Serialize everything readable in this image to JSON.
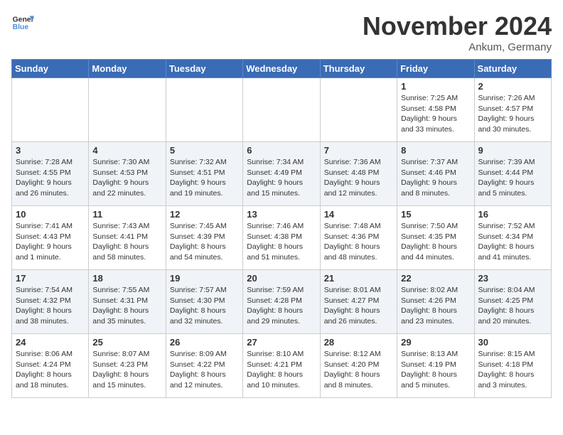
{
  "header": {
    "logo_general": "General",
    "logo_blue": "Blue",
    "month_title": "November 2024",
    "location": "Ankum, Germany"
  },
  "weekdays": [
    "Sunday",
    "Monday",
    "Tuesday",
    "Wednesday",
    "Thursday",
    "Friday",
    "Saturday"
  ],
  "weeks": [
    [
      {
        "day": "",
        "info": ""
      },
      {
        "day": "",
        "info": ""
      },
      {
        "day": "",
        "info": ""
      },
      {
        "day": "",
        "info": ""
      },
      {
        "day": "",
        "info": ""
      },
      {
        "day": "1",
        "info": "Sunrise: 7:25 AM\nSunset: 4:58 PM\nDaylight: 9 hours and 33 minutes."
      },
      {
        "day": "2",
        "info": "Sunrise: 7:26 AM\nSunset: 4:57 PM\nDaylight: 9 hours and 30 minutes."
      }
    ],
    [
      {
        "day": "3",
        "info": "Sunrise: 7:28 AM\nSunset: 4:55 PM\nDaylight: 9 hours and 26 minutes."
      },
      {
        "day": "4",
        "info": "Sunrise: 7:30 AM\nSunset: 4:53 PM\nDaylight: 9 hours and 22 minutes."
      },
      {
        "day": "5",
        "info": "Sunrise: 7:32 AM\nSunset: 4:51 PM\nDaylight: 9 hours and 19 minutes."
      },
      {
        "day": "6",
        "info": "Sunrise: 7:34 AM\nSunset: 4:49 PM\nDaylight: 9 hours and 15 minutes."
      },
      {
        "day": "7",
        "info": "Sunrise: 7:36 AM\nSunset: 4:48 PM\nDaylight: 9 hours and 12 minutes."
      },
      {
        "day": "8",
        "info": "Sunrise: 7:37 AM\nSunset: 4:46 PM\nDaylight: 9 hours and 8 minutes."
      },
      {
        "day": "9",
        "info": "Sunrise: 7:39 AM\nSunset: 4:44 PM\nDaylight: 9 hours and 5 minutes."
      }
    ],
    [
      {
        "day": "10",
        "info": "Sunrise: 7:41 AM\nSunset: 4:43 PM\nDaylight: 9 hours and 1 minute."
      },
      {
        "day": "11",
        "info": "Sunrise: 7:43 AM\nSunset: 4:41 PM\nDaylight: 8 hours and 58 minutes."
      },
      {
        "day": "12",
        "info": "Sunrise: 7:45 AM\nSunset: 4:39 PM\nDaylight: 8 hours and 54 minutes."
      },
      {
        "day": "13",
        "info": "Sunrise: 7:46 AM\nSunset: 4:38 PM\nDaylight: 8 hours and 51 minutes."
      },
      {
        "day": "14",
        "info": "Sunrise: 7:48 AM\nSunset: 4:36 PM\nDaylight: 8 hours and 48 minutes."
      },
      {
        "day": "15",
        "info": "Sunrise: 7:50 AM\nSunset: 4:35 PM\nDaylight: 8 hours and 44 minutes."
      },
      {
        "day": "16",
        "info": "Sunrise: 7:52 AM\nSunset: 4:34 PM\nDaylight: 8 hours and 41 minutes."
      }
    ],
    [
      {
        "day": "17",
        "info": "Sunrise: 7:54 AM\nSunset: 4:32 PM\nDaylight: 8 hours and 38 minutes."
      },
      {
        "day": "18",
        "info": "Sunrise: 7:55 AM\nSunset: 4:31 PM\nDaylight: 8 hours and 35 minutes."
      },
      {
        "day": "19",
        "info": "Sunrise: 7:57 AM\nSunset: 4:30 PM\nDaylight: 8 hours and 32 minutes."
      },
      {
        "day": "20",
        "info": "Sunrise: 7:59 AM\nSunset: 4:28 PM\nDaylight: 8 hours and 29 minutes."
      },
      {
        "day": "21",
        "info": "Sunrise: 8:01 AM\nSunset: 4:27 PM\nDaylight: 8 hours and 26 minutes."
      },
      {
        "day": "22",
        "info": "Sunrise: 8:02 AM\nSunset: 4:26 PM\nDaylight: 8 hours and 23 minutes."
      },
      {
        "day": "23",
        "info": "Sunrise: 8:04 AM\nSunset: 4:25 PM\nDaylight: 8 hours and 20 minutes."
      }
    ],
    [
      {
        "day": "24",
        "info": "Sunrise: 8:06 AM\nSunset: 4:24 PM\nDaylight: 8 hours and 18 minutes."
      },
      {
        "day": "25",
        "info": "Sunrise: 8:07 AM\nSunset: 4:23 PM\nDaylight: 8 hours and 15 minutes."
      },
      {
        "day": "26",
        "info": "Sunrise: 8:09 AM\nSunset: 4:22 PM\nDaylight: 8 hours and 12 minutes."
      },
      {
        "day": "27",
        "info": "Sunrise: 8:10 AM\nSunset: 4:21 PM\nDaylight: 8 hours and 10 minutes."
      },
      {
        "day": "28",
        "info": "Sunrise: 8:12 AM\nSunset: 4:20 PM\nDaylight: 8 hours and 8 minutes."
      },
      {
        "day": "29",
        "info": "Sunrise: 8:13 AM\nSunset: 4:19 PM\nDaylight: 8 hours and 5 minutes."
      },
      {
        "day": "30",
        "info": "Sunrise: 8:15 AM\nSunset: 4:18 PM\nDaylight: 8 hours and 3 minutes."
      }
    ]
  ]
}
